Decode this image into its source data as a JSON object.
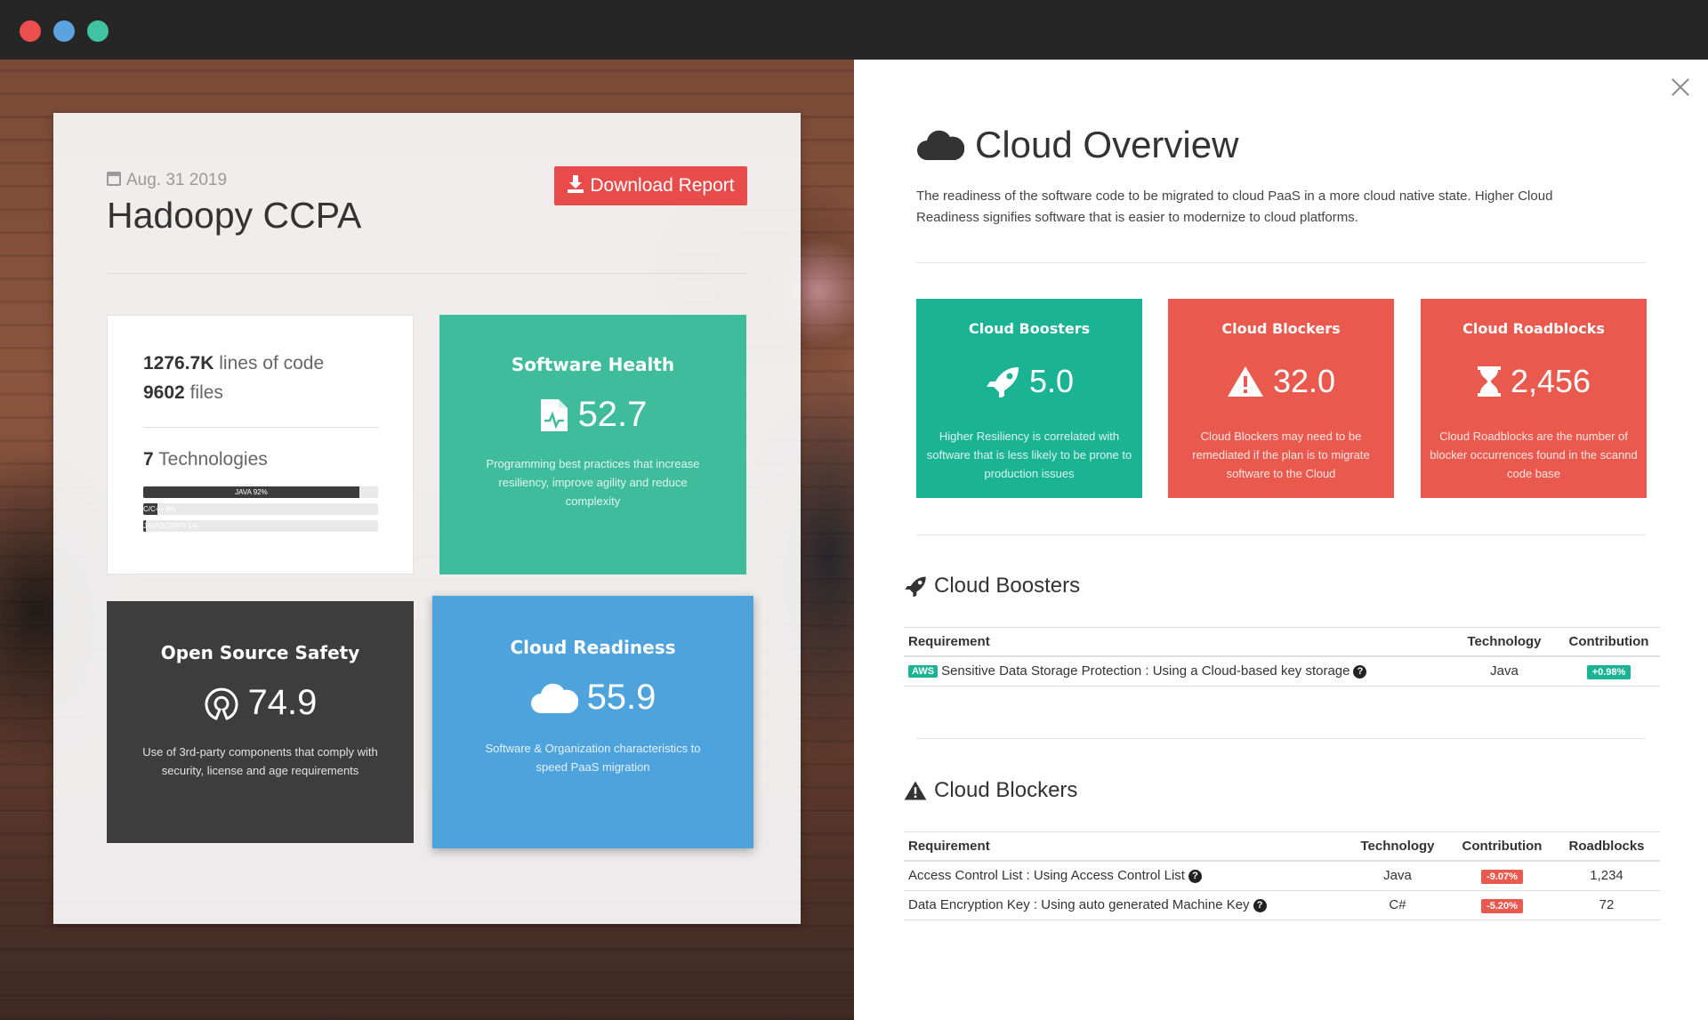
{
  "window": {
    "controls": [
      "close",
      "minimize",
      "zoom"
    ]
  },
  "report": {
    "date": "Aug. 31 2019",
    "title": "Hadoopy CCPA",
    "download_label": "Download Report"
  },
  "stats": {
    "loc_value": "1276.7K",
    "loc_label": "lines of code",
    "files_value": "9602",
    "files_label": "files",
    "tech_value": "7",
    "tech_label": "Technologies",
    "technologies": [
      {
        "label": "JAVA 92%",
        "percent": 92
      },
      {
        "label": "C/C++ 6%",
        "percent": 6
      },
      {
        "label": "JAVASCRIPT 1%",
        "percent": 1
      }
    ]
  },
  "tiles": {
    "health": {
      "title": "Software Health",
      "value": "52.7",
      "desc": "Programming best practices that increase resiliency, improve agility and reduce complexity",
      "icon": "file-medical-icon"
    },
    "oss": {
      "title": "Open Source Safety",
      "value": "74.9",
      "desc": "Use of 3rd-party components that comply with security, license and age requirements",
      "icon": "open-source-icon"
    },
    "readiness": {
      "title": "Cloud Readiness",
      "value": "55.9",
      "desc": "Software & Organization characteristics to speed PaaS migration",
      "icon": "cloud-icon"
    }
  },
  "overview": {
    "title": "Cloud Overview",
    "description": "The readiness of the software code to be migrated to cloud PaaS in a more cloud native state. Higher Cloud Readiness signifies software that is easier to modernize to cloud platforms."
  },
  "summary": {
    "boosters": {
      "title": "Cloud Boosters",
      "value": "5.0",
      "desc": "Higher Resiliency is correlated with software that is less likely to be prone to production issues",
      "icon": "rocket-icon"
    },
    "blockers": {
      "title": "Cloud Blockers",
      "value": "32.0",
      "desc": "Cloud Blockers may need to be remediated if the plan is to migrate software to the Cloud",
      "icon": "warning-icon"
    },
    "roadblocks": {
      "title": "Cloud Roadblocks",
      "value": "2,456",
      "desc": "Cloud Roadblocks are the number of blocker occurrences found in the scannd code base",
      "icon": "hourglass-icon"
    }
  },
  "boosters_section": {
    "heading": "Cloud Boosters",
    "columns": [
      "Requirement",
      "Technology",
      "Contribution"
    ],
    "rows": [
      {
        "tag": "AWS",
        "requirement": "Sensitive Data Storage Protection : Using a Cloud-based key storage",
        "technology": "Java",
        "contribution": "+0.98%"
      }
    ]
  },
  "blockers_section": {
    "heading": "Cloud Blockers",
    "columns": [
      "Requirement",
      "Technology",
      "Contribution",
      "Roadblocks"
    ],
    "rows": [
      {
        "requirement": "Access Control List : Using Access Control List",
        "technology": "Java",
        "contribution": "-9.07%",
        "roadblocks": "1,234"
      },
      {
        "requirement": "Data Encryption Key : Using auto generated Machine Key",
        "technology": "C#",
        "contribution": "-5.20%",
        "roadblocks": "72"
      }
    ]
  },
  "colors": {
    "green": "#1ab394",
    "red": "#e9594d",
    "blue": "#4ea3dd",
    "dark": "#3d3d3d",
    "download": "#e74c4a"
  }
}
